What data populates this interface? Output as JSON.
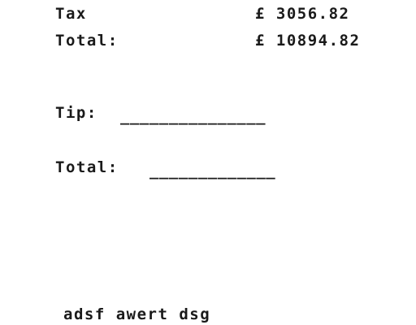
{
  "summary": {
    "tax_label": "Tax",
    "tax_amount": "£ 3056.82",
    "total_label": "Total:",
    "total_amount": "£ 10894.82"
  },
  "fill_in": {
    "tip_label": "Tip:",
    "tip_blank": "_______________",
    "total_label": "Total:",
    "total_blank": "_____________"
  },
  "footer": {
    "text": "adsf awert dsg"
  }
}
